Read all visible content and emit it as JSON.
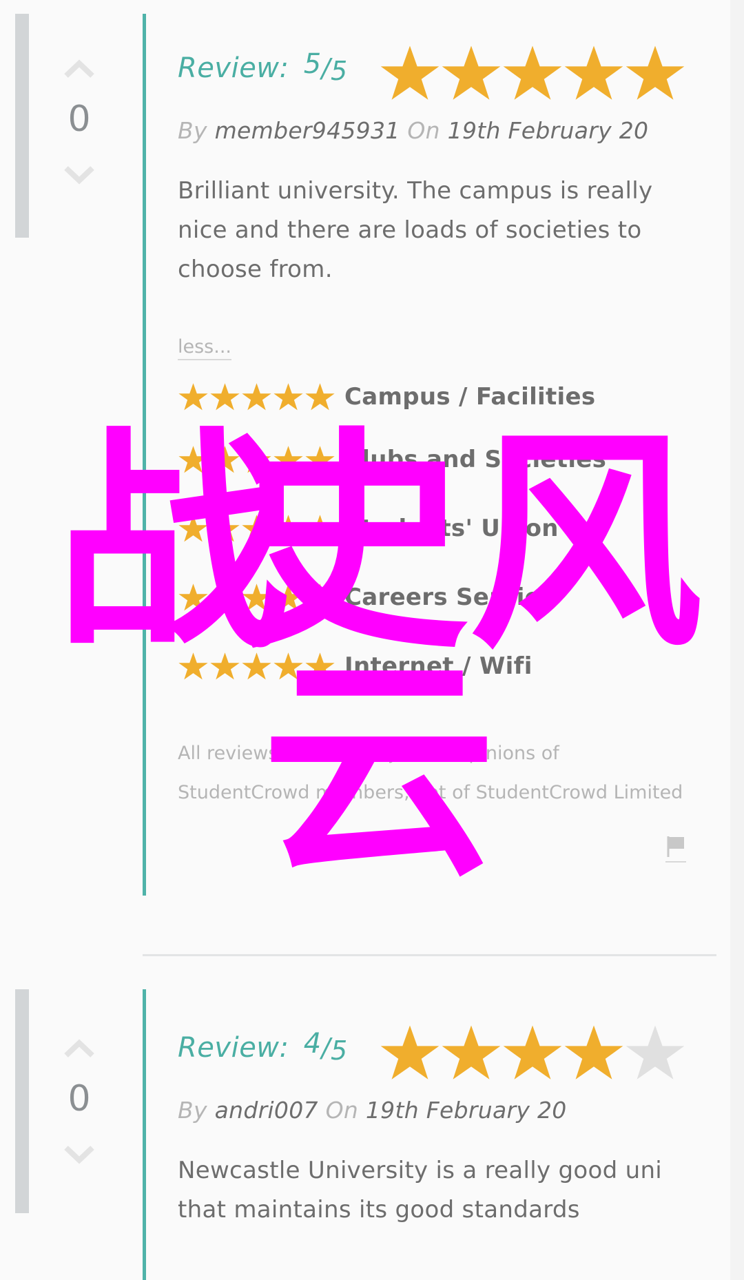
{
  "reviews": [
    {
      "votes": "0",
      "review_label": "Review:",
      "score": "5",
      "slash": "/",
      "out_of": "5",
      "rating": 5,
      "by_label": "By",
      "author": "member945931",
      "on_label": "On",
      "date": "19th February 20",
      "text": "Brilliant university. The campus is really nice and there are loads of societies to choose from.",
      "less_label": "less...",
      "categories": [
        {
          "label": "Campus / Facilities",
          "rating": 5
        },
        {
          "label": "Clubs and Societies",
          "rating": 5
        },
        {
          "label": "Students' Union",
          "rating": 5
        },
        {
          "label": "Careers Service",
          "rating": 5
        },
        {
          "label": "Internet / Wifi",
          "rating": 5
        }
      ],
      "disclaimer": "All reviews are the subjective opinions of StudentCrowd members, not of StudentCrowd Limited"
    },
    {
      "votes": "0",
      "review_label": "Review:",
      "score": "4",
      "slash": "/",
      "out_of": "5",
      "rating": 4,
      "by_label": "By",
      "author": "andri007",
      "on_label": "On",
      "date": "19th February 20",
      "text": "Newcastle University is a really good uni that maintains its good standards"
    }
  ],
  "overlay": {
    "line1": [
      "战",
      "史",
      "风"
    ],
    "line2": "云"
  },
  "colors": {
    "accent": "#4fb3a9",
    "star_filled": "#f0ae2d",
    "star_empty": "#e0e0e0",
    "vote_bar": "#d2d5d7",
    "overlay": "#ff00ff"
  },
  "icons": {
    "upvote": "chevron-up-icon",
    "downvote": "chevron-down-icon",
    "flag": "flag-icon",
    "star": "star-icon"
  }
}
